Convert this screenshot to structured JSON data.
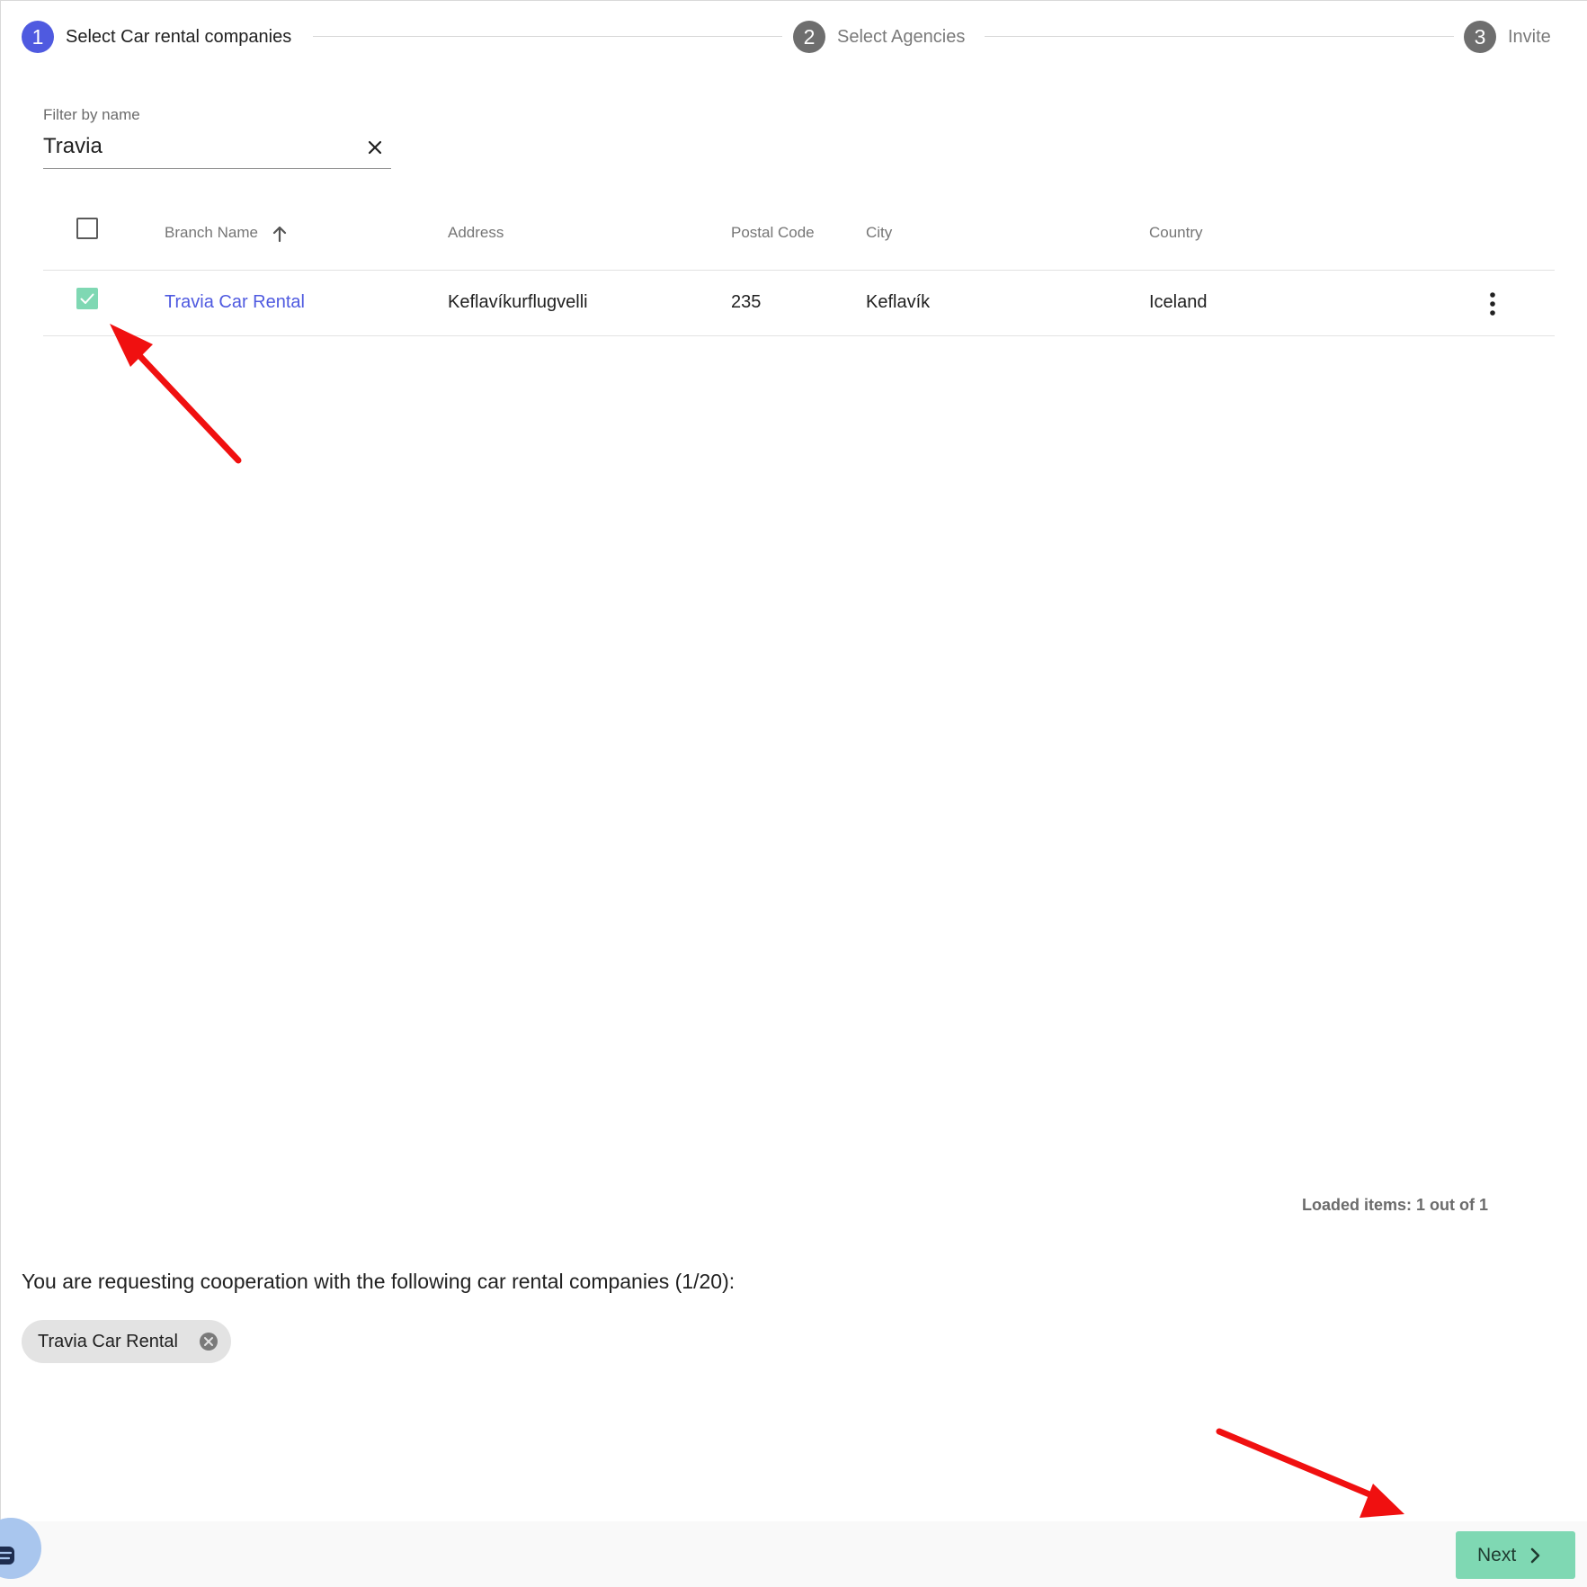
{
  "stepper": {
    "steps": [
      {
        "number": "1",
        "label": "Select Car rental companies"
      },
      {
        "number": "2",
        "label": "Select Agencies"
      },
      {
        "number": "3",
        "label": "Invite"
      }
    ]
  },
  "filter": {
    "label": "Filter by name",
    "value": "Travia"
  },
  "table": {
    "headers": {
      "branch_name": "Branch Name",
      "address": "Address",
      "postal_code": "Postal Code",
      "city": "City",
      "country": "Country"
    },
    "rows": [
      {
        "checked": true,
        "branch_name": "Travia Car Rental",
        "address": "Keflavíkurflugvelli",
        "postal_code": "235",
        "city": "Keflavík",
        "country": "Iceland"
      }
    ]
  },
  "pagination": {
    "loaded_text": "Loaded items: 1 out of 1"
  },
  "selection": {
    "requesting_text": "You are requesting cooperation with the following car rental companies (1/20):",
    "chips": [
      "Travia Car Rental"
    ]
  },
  "actions": {
    "next_label": "Next"
  },
  "colors": {
    "primary": "#4f5ae0",
    "accent_green": "#7fd8b3",
    "annotation_red": "#f01010"
  },
  "icons": {
    "clear": "close-icon",
    "sort": "arrow-up-icon",
    "row_menu": "more-vertical-icon",
    "chip_remove": "cancel-circle-icon",
    "next": "chevron-right-icon",
    "chat": "chat-icon"
  }
}
